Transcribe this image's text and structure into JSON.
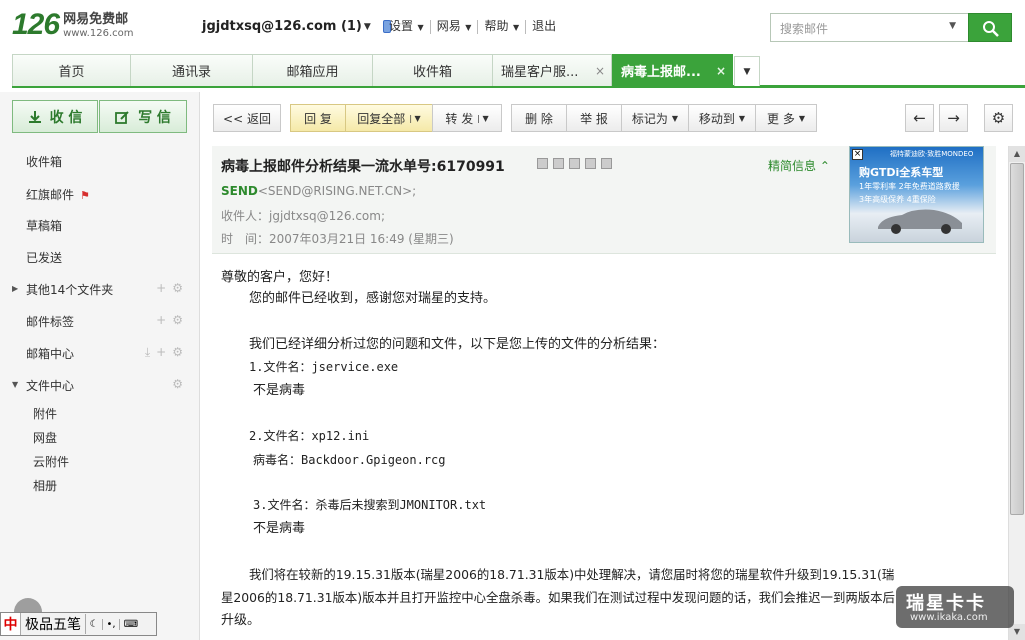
{
  "logo": {
    "num": "126",
    "name": "网易免费邮",
    "url": "www.126.com"
  },
  "user": {
    "account": "jgjdtxsq@126.com (1)"
  },
  "topnav": [
    "设置",
    "网易",
    "帮助",
    "退出"
  ],
  "search": {
    "placeholder": "搜索邮件"
  },
  "tabs": [
    {
      "label": "首页"
    },
    {
      "label": "通讯录"
    },
    {
      "label": "邮箱应用"
    },
    {
      "label": "收件箱"
    },
    {
      "label": "瑞星客户服..."
    },
    {
      "label": "病毒上报邮..."
    }
  ],
  "sidebar": {
    "receive": "收 信",
    "write": "写 信",
    "items": [
      "收件箱",
      "红旗邮件",
      "草稿箱",
      "已发送",
      "其他14个文件夹",
      "邮件标签",
      "邮箱中心",
      "文件中心"
    ],
    "sub": [
      "附件",
      "网盘",
      "云附件",
      "相册"
    ]
  },
  "toolbar": {
    "back": "<< 返回",
    "reply": "回 复",
    "reply_all": "回复全部",
    "forward": "转 发",
    "delete": "删 除",
    "report": "举 报",
    "mark": "标记为",
    "move": "移动到",
    "more": "更 多"
  },
  "mail": {
    "subject": "病毒上报邮件分析结果一流水单号:6170991",
    "brief": "精简信息",
    "from_name": "SEND",
    "from_addr": "<SEND@RISING.NET.CN>;",
    "to_label": "收件人：",
    "to_addr": "jgjdtxsq@126.com;",
    "time_label": "时　间：",
    "time_value": "2007年03月21日 16:49 (星期三)",
    "body": [
      "尊敬的客户，您好！",
      "您的邮件已经收到，感谢您对瑞星的支持。",
      "我们已经详细分析过您的问题和文件，以下是您上传的文件的分析结果：",
      "1.文件名：jservice.exe",
      "不是病毒",
      "2.文件名：xp12.ini",
      "病毒名：Backdoor.Gpigeon.rcg",
      "3.文件名：杀毒后未搜索到JMONITOR.txt",
      "不是病毒",
      "我们将在较新的19.15.31版本(瑞星2006的18.71.31版本)中处理解决，请您届时将您的瑞星软件升级到19.15.31(瑞",
      "星2006的18.71.31版本)版本并且打开监控中心全盘杀毒。如果我们在测试过程中发现问题的话，我们会推迟一到两版本后",
      "升级。"
    ]
  },
  "ad": {
    "brand": "福特蒙迪欧·致胜MONDEO",
    "title": "购GTDi全系车型",
    "line1": "1年零利率 2年免费道路救援",
    "line2": "3年高级保养 4重保险"
  },
  "ime": {
    "logo": "中",
    "name": "极品五笔"
  },
  "watermark": {
    "text": "瑞星卡卡",
    "url": "www.ikaka.com"
  }
}
